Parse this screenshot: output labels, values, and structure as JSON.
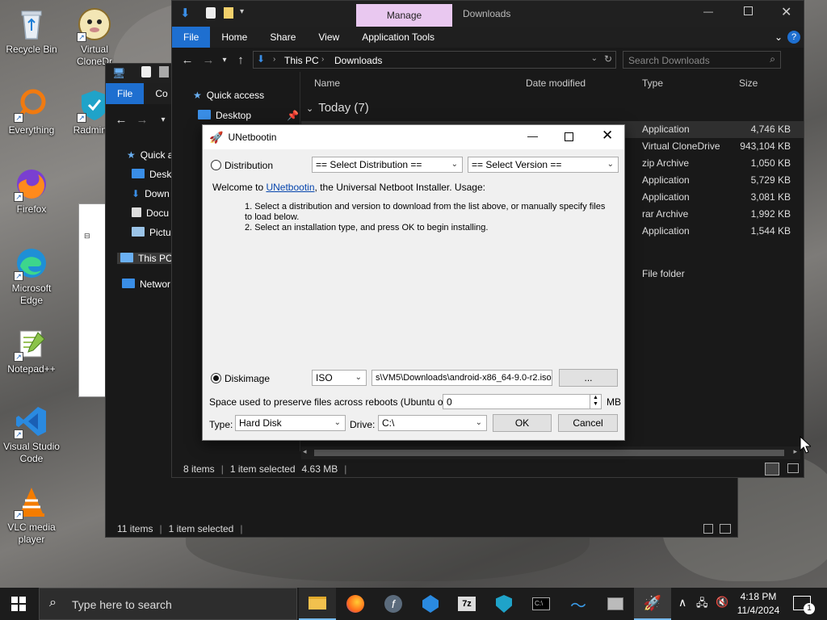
{
  "desktop": {
    "icons": [
      {
        "label": "Recycle Bin",
        "icon": "recycle-bin-icon"
      },
      {
        "label": "Virtual CloneDr",
        "icon": "virtual-clonedrive-icon"
      },
      {
        "label": "Everything",
        "icon": "everything-icon"
      },
      {
        "label": "Radmin V",
        "icon": "radmin-vpn-icon"
      },
      {
        "label": "Firefox",
        "icon": "firefox-icon"
      },
      {
        "label": "Microsoft Edge",
        "icon": "edge-icon"
      },
      {
        "label": "Notepad++",
        "icon": "notepadpp-icon"
      },
      {
        "label": "Visual Studio Code",
        "icon": "vscode-icon"
      },
      {
        "label": "VLC media player",
        "icon": "vlc-icon"
      }
    ]
  },
  "explorer_back": {
    "ribbon": {
      "file": "File",
      "co": "Co"
    },
    "sidebar": [
      "Quick a",
      "Deskt",
      "Down",
      "Docu",
      "Pictur",
      "This PC",
      "Networ"
    ],
    "status": {
      "items": "11 items",
      "selected": "1 item selected"
    }
  },
  "explorer_front": {
    "manage_tab": "Manage",
    "title": "Downloads",
    "ribbon": [
      "File",
      "Home",
      "Share",
      "View",
      "Application Tools"
    ],
    "address": {
      "root": "This PC",
      "folder": "Downloads"
    },
    "search_placeholder": "Search Downloads",
    "sidebar": [
      "Quick access",
      "Desktop"
    ],
    "columns": {
      "name": "Name",
      "date": "Date modified",
      "type": "Type",
      "size": "Size"
    },
    "group": "Today (7)",
    "rows": [
      {
        "type": "Application",
        "size": "4,746 KB"
      },
      {
        "type": "Virtual CloneDrive",
        "size": "943,104 KB"
      },
      {
        "type": "zip Archive",
        "size": "1,050 KB"
      },
      {
        "type": "Application",
        "size": "5,729 KB"
      },
      {
        "type": "Application",
        "size": "3,081 KB"
      },
      {
        "type": "rar Archive",
        "size": "1,992 KB"
      },
      {
        "type": "Application",
        "size": "1,544 KB"
      },
      {
        "type": "File folder",
        "size": ""
      }
    ],
    "status": {
      "items": "8 items",
      "selected": "1 item selected",
      "size": "4.63 MB"
    }
  },
  "unetbootin": {
    "title": "UNetbootin",
    "distribution_label": "Distribution",
    "select_distribution": "== Select Distribution ==",
    "select_version": "== Select Version ==",
    "welcome_prefix": "Welcome to ",
    "welcome_link": "UNetbootin",
    "welcome_suffix": ", the Universal Netboot Installer. Usage:",
    "steps": [
      "1. Select a distribution and version to download from the list above, or manually specify files to load below.",
      "2. Select an installation type, and press OK to begin installing."
    ],
    "diskimage_label": "Diskimage",
    "image_type": "ISO",
    "image_path": "s\\VM5\\Downloads\\android-x86_64-9.0-r2.iso",
    "browse": "...",
    "space_label": "Space used to preserve files across reboots (Ubuntu only):",
    "space_value": "0",
    "space_unit": "MB",
    "type_label": "Type:",
    "type_value": "Hard Disk",
    "drive_label": "Drive:",
    "drive_value": "C:\\",
    "ok": "OK",
    "cancel": "Cancel"
  },
  "taskbar": {
    "search_placeholder": "Type here to search",
    "time": "4:18 PM",
    "date": "11/4/2024",
    "notification_count": "1"
  }
}
